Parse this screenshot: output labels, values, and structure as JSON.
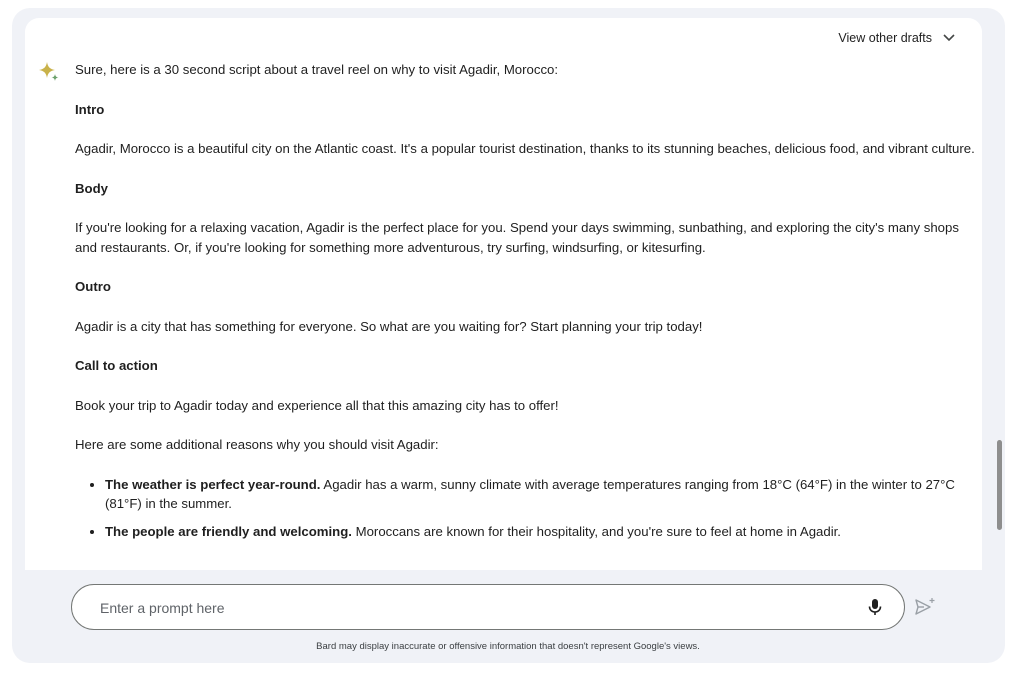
{
  "header": {
    "view_drafts_label": "View other drafts"
  },
  "response": {
    "intro_line": "Sure, here is a 30 second script about a travel reel on why to visit Agadir, Morocco:",
    "sections": [
      {
        "heading": "Intro",
        "text": "Agadir, Morocco is a beautiful city on the Atlantic coast. It's a popular tourist destination, thanks to its stunning beaches, delicious food, and vibrant culture."
      },
      {
        "heading": "Body",
        "text": "If you're looking for a relaxing vacation, Agadir is the perfect place for you. Spend your days swimming, sunbathing, and exploring the city's many shops and restaurants. Or, if you're looking for something more adventurous, try surfing, windsurfing, or kitesurfing."
      },
      {
        "heading": "Outro",
        "text": "Agadir is a city that has something for everyone. So what are you waiting for? Start planning your trip today!"
      },
      {
        "heading": "Call to action",
        "text": "Book your trip to Agadir today and experience all that this amazing city has to offer!"
      }
    ],
    "reasons_intro": "Here are some additional reasons why you should visit Agadir:",
    "bullets": [
      {
        "bold": "The weather is perfect year-round.",
        "text": " Agadir has a warm, sunny climate with average temperatures ranging from 18°C (64°F) in the winter to 27°C (81°F) in the summer."
      },
      {
        "bold": "The people are friendly and welcoming.",
        "text": " Moroccans are known for their hospitality, and you're sure to feel at home in Agadir."
      }
    ]
  },
  "prompt": {
    "placeholder": "Enter a prompt here"
  },
  "icons": {
    "assistant": "sparkle-icon",
    "mic": "mic-icon",
    "send": "send-icon",
    "drafts": "chevron-down-icon"
  },
  "colors": {
    "spark_primary": "#c9b24a",
    "spark_secondary": "#6ba06b"
  },
  "footer": {
    "disclaimer": "Bard may display inaccurate or offensive information that doesn't represent Google's views."
  }
}
